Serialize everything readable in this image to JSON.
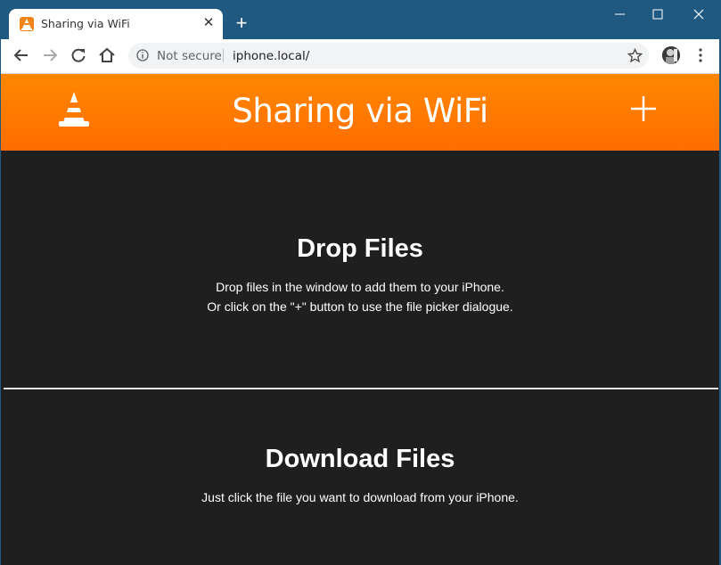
{
  "browser": {
    "tab_title": "Sharing via WiFi",
    "tab_close": "✕",
    "new_tab": "+",
    "security_label": "Not secure",
    "url": "iphone.local/"
  },
  "header": {
    "title": "Sharing via WiFi",
    "brand_color": "#ff7a00"
  },
  "drop_section": {
    "title": "Drop Files",
    "line1": "Drop files in the window to add them to your iPhone.",
    "line2": "Or click on the \"+\" button to use the file picker dialogue."
  },
  "download_section": {
    "title": "Download Files",
    "text": "Just click the file you want to download from your iPhone."
  },
  "icons": {
    "logo": "vlc-cone-icon",
    "add": "plus-icon"
  }
}
